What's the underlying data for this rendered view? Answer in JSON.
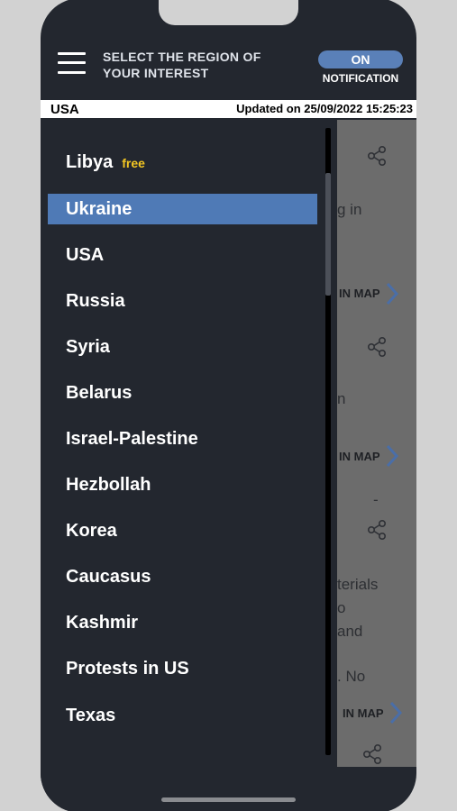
{
  "header": {
    "title": "SELECT THE REGION OF YOUR INTEREST",
    "toggle_label": "ON",
    "notification_label": "NOTIFICATION"
  },
  "infobar": {
    "region": "USA",
    "updated": "Updated on 25/09/2022 15:25:23"
  },
  "drawer": {
    "items": [
      {
        "label": "Libya",
        "badge": "free"
      },
      {
        "label": "Ukraine",
        "selected": true
      },
      {
        "label": "USA"
      },
      {
        "label": "Russia"
      },
      {
        "label": "Syria"
      },
      {
        "label": "Belarus"
      },
      {
        "label": "Israel-Palestine"
      },
      {
        "label": "Hezbollah"
      },
      {
        "label": "Korea"
      },
      {
        "label": "Caucasus"
      },
      {
        "label": "Kashmir"
      },
      {
        "label": "Protests in US"
      },
      {
        "label": "Texas"
      }
    ]
  },
  "background": {
    "fragments": [
      "g in",
      "IN MAP",
      "n",
      "IN MAP",
      "-",
      "terials",
      "o",
      "and",
      ". No",
      "IN MAP"
    ]
  },
  "colors": {
    "panel": "#23272f",
    "selected": "#4f7ab6",
    "toggle": "#5a80b8",
    "badge": "#f3c623",
    "overlay": "#6c6c6c"
  }
}
